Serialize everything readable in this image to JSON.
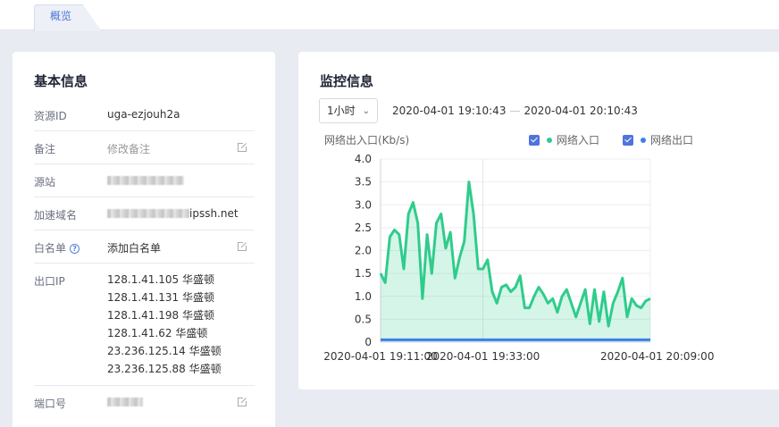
{
  "tabs": [
    {
      "label": "概览",
      "active": true
    }
  ],
  "basic_info": {
    "title": "基本信息",
    "rows": {
      "resource_id": {
        "label": "资源ID",
        "value": "uga-ezjouh2a"
      },
      "remark": {
        "label": "备注",
        "placeholder": "修改备注"
      },
      "origin": {
        "label": "源站"
      },
      "domain": {
        "label": "加速域名",
        "value_suffix": "ipssh.net"
      },
      "whitelist": {
        "label": "白名单",
        "value": "添加白名单"
      },
      "egress_ip": {
        "label": "出口IP",
        "values": [
          "128.1.41.105 华盛顿",
          "128.1.41.131 华盛顿",
          "128.1.41.198 华盛顿",
          "128.1.41.62 华盛顿",
          "23.236.125.14 华盛顿",
          "23.236.125.88 华盛顿"
        ]
      },
      "port": {
        "label": "端口号"
      }
    }
  },
  "monitor": {
    "title": "监控信息",
    "time_range_select": "1小时",
    "start_time": "2020-04-01 19:10:43",
    "end_time": "2020-04-01 20:10:43",
    "range_separator": "—",
    "legend": [
      {
        "label": "网络入口",
        "checked": true,
        "color": "#2fcc8b"
      },
      {
        "label": "网络出口",
        "checked": true,
        "color": "#3f7ee8"
      }
    ]
  },
  "chart_data": {
    "type": "area",
    "ylabel": "网络出入口(Kb/s)",
    "ylim": [
      0,
      4.0
    ],
    "y_ticks": [
      "0",
      "0.5",
      "1.0",
      "1.5",
      "2.0",
      "2.5",
      "3.0",
      "3.5",
      "4.0"
    ],
    "x_ticks": [
      {
        "label": "2020-04-01 19:11:00",
        "t": 0
      },
      {
        "label": "2020-04-01 19:33:00",
        "t": 22
      },
      {
        "label": "2020-04-01 20:09:00",
        "t": 58
      }
    ],
    "grid": true,
    "series": [
      {
        "name": "网络入口",
        "color": "#2fcc8b",
        "x": [
          0,
          1,
          2,
          3,
          4,
          5,
          6,
          7,
          8,
          9,
          10,
          11,
          12,
          13,
          14,
          15,
          16,
          17,
          18,
          19,
          20,
          21,
          22,
          23,
          24,
          25,
          26,
          27,
          28,
          29,
          30,
          31,
          32,
          33,
          34,
          35,
          36,
          37,
          38,
          39,
          40,
          41,
          42,
          43,
          44,
          45,
          46,
          47,
          48,
          49,
          50,
          51,
          52,
          53,
          54,
          55,
          56,
          57,
          58
        ],
        "values": [
          1.5,
          1.3,
          2.3,
          2.45,
          2.35,
          1.6,
          2.8,
          3.05,
          2.6,
          0.95,
          2.35,
          1.5,
          2.6,
          2.8,
          2.05,
          2.4,
          1.4,
          1.85,
          2.2,
          3.5,
          2.8,
          1.6,
          1.6,
          1.8,
          1.1,
          0.85,
          1.2,
          1.25,
          1.1,
          1.2,
          1.45,
          0.75,
          0.75,
          1.0,
          1.2,
          1.05,
          0.85,
          0.95,
          0.65,
          1.0,
          1.15,
          0.85,
          0.55,
          0.85,
          1.15,
          0.4,
          1.15,
          0.45,
          1.1,
          0.35,
          0.85,
          1.1,
          1.4,
          0.55,
          0.95,
          0.8,
          0.75,
          0.9,
          0.95
        ]
      },
      {
        "name": "网络出口",
        "color": "#3f7ee8",
        "x": [
          0,
          58
        ],
        "values": [
          0.05,
          0.05
        ]
      }
    ]
  }
}
